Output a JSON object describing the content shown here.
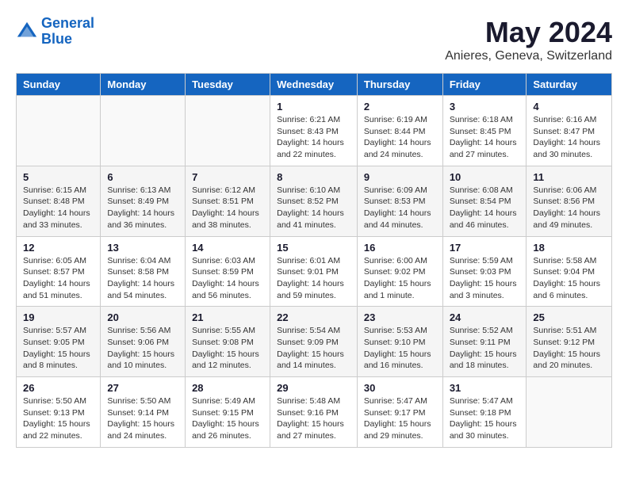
{
  "logo": {
    "line1": "General",
    "line2": "Blue"
  },
  "title": "May 2024",
  "subtitle": "Anieres, Geneva, Switzerland",
  "days_of_week": [
    "Sunday",
    "Monday",
    "Tuesday",
    "Wednesday",
    "Thursday",
    "Friday",
    "Saturday"
  ],
  "weeks": [
    [
      {
        "day": "",
        "info": ""
      },
      {
        "day": "",
        "info": ""
      },
      {
        "day": "",
        "info": ""
      },
      {
        "day": "1",
        "info": "Sunrise: 6:21 AM\nSunset: 8:43 PM\nDaylight: 14 hours\nand 22 minutes."
      },
      {
        "day": "2",
        "info": "Sunrise: 6:19 AM\nSunset: 8:44 PM\nDaylight: 14 hours\nand 24 minutes."
      },
      {
        "day": "3",
        "info": "Sunrise: 6:18 AM\nSunset: 8:45 PM\nDaylight: 14 hours\nand 27 minutes."
      },
      {
        "day": "4",
        "info": "Sunrise: 6:16 AM\nSunset: 8:47 PM\nDaylight: 14 hours\nand 30 minutes."
      }
    ],
    [
      {
        "day": "5",
        "info": "Sunrise: 6:15 AM\nSunset: 8:48 PM\nDaylight: 14 hours\nand 33 minutes."
      },
      {
        "day": "6",
        "info": "Sunrise: 6:13 AM\nSunset: 8:49 PM\nDaylight: 14 hours\nand 36 minutes."
      },
      {
        "day": "7",
        "info": "Sunrise: 6:12 AM\nSunset: 8:51 PM\nDaylight: 14 hours\nand 38 minutes."
      },
      {
        "day": "8",
        "info": "Sunrise: 6:10 AM\nSunset: 8:52 PM\nDaylight: 14 hours\nand 41 minutes."
      },
      {
        "day": "9",
        "info": "Sunrise: 6:09 AM\nSunset: 8:53 PM\nDaylight: 14 hours\nand 44 minutes."
      },
      {
        "day": "10",
        "info": "Sunrise: 6:08 AM\nSunset: 8:54 PM\nDaylight: 14 hours\nand 46 minutes."
      },
      {
        "day": "11",
        "info": "Sunrise: 6:06 AM\nSunset: 8:56 PM\nDaylight: 14 hours\nand 49 minutes."
      }
    ],
    [
      {
        "day": "12",
        "info": "Sunrise: 6:05 AM\nSunset: 8:57 PM\nDaylight: 14 hours\nand 51 minutes."
      },
      {
        "day": "13",
        "info": "Sunrise: 6:04 AM\nSunset: 8:58 PM\nDaylight: 14 hours\nand 54 minutes."
      },
      {
        "day": "14",
        "info": "Sunrise: 6:03 AM\nSunset: 8:59 PM\nDaylight: 14 hours\nand 56 minutes."
      },
      {
        "day": "15",
        "info": "Sunrise: 6:01 AM\nSunset: 9:01 PM\nDaylight: 14 hours\nand 59 minutes."
      },
      {
        "day": "16",
        "info": "Sunrise: 6:00 AM\nSunset: 9:02 PM\nDaylight: 15 hours\nand 1 minute."
      },
      {
        "day": "17",
        "info": "Sunrise: 5:59 AM\nSunset: 9:03 PM\nDaylight: 15 hours\nand 3 minutes."
      },
      {
        "day": "18",
        "info": "Sunrise: 5:58 AM\nSunset: 9:04 PM\nDaylight: 15 hours\nand 6 minutes."
      }
    ],
    [
      {
        "day": "19",
        "info": "Sunrise: 5:57 AM\nSunset: 9:05 PM\nDaylight: 15 hours\nand 8 minutes."
      },
      {
        "day": "20",
        "info": "Sunrise: 5:56 AM\nSunset: 9:06 PM\nDaylight: 15 hours\nand 10 minutes."
      },
      {
        "day": "21",
        "info": "Sunrise: 5:55 AM\nSunset: 9:08 PM\nDaylight: 15 hours\nand 12 minutes."
      },
      {
        "day": "22",
        "info": "Sunrise: 5:54 AM\nSunset: 9:09 PM\nDaylight: 15 hours\nand 14 minutes."
      },
      {
        "day": "23",
        "info": "Sunrise: 5:53 AM\nSunset: 9:10 PM\nDaylight: 15 hours\nand 16 minutes."
      },
      {
        "day": "24",
        "info": "Sunrise: 5:52 AM\nSunset: 9:11 PM\nDaylight: 15 hours\nand 18 minutes."
      },
      {
        "day": "25",
        "info": "Sunrise: 5:51 AM\nSunset: 9:12 PM\nDaylight: 15 hours\nand 20 minutes."
      }
    ],
    [
      {
        "day": "26",
        "info": "Sunrise: 5:50 AM\nSunset: 9:13 PM\nDaylight: 15 hours\nand 22 minutes."
      },
      {
        "day": "27",
        "info": "Sunrise: 5:50 AM\nSunset: 9:14 PM\nDaylight: 15 hours\nand 24 minutes."
      },
      {
        "day": "28",
        "info": "Sunrise: 5:49 AM\nSunset: 9:15 PM\nDaylight: 15 hours\nand 26 minutes."
      },
      {
        "day": "29",
        "info": "Sunrise: 5:48 AM\nSunset: 9:16 PM\nDaylight: 15 hours\nand 27 minutes."
      },
      {
        "day": "30",
        "info": "Sunrise: 5:47 AM\nSunset: 9:17 PM\nDaylight: 15 hours\nand 29 minutes."
      },
      {
        "day": "31",
        "info": "Sunrise: 5:47 AM\nSunset: 9:18 PM\nDaylight: 15 hours\nand 30 minutes."
      },
      {
        "day": "",
        "info": ""
      }
    ]
  ]
}
